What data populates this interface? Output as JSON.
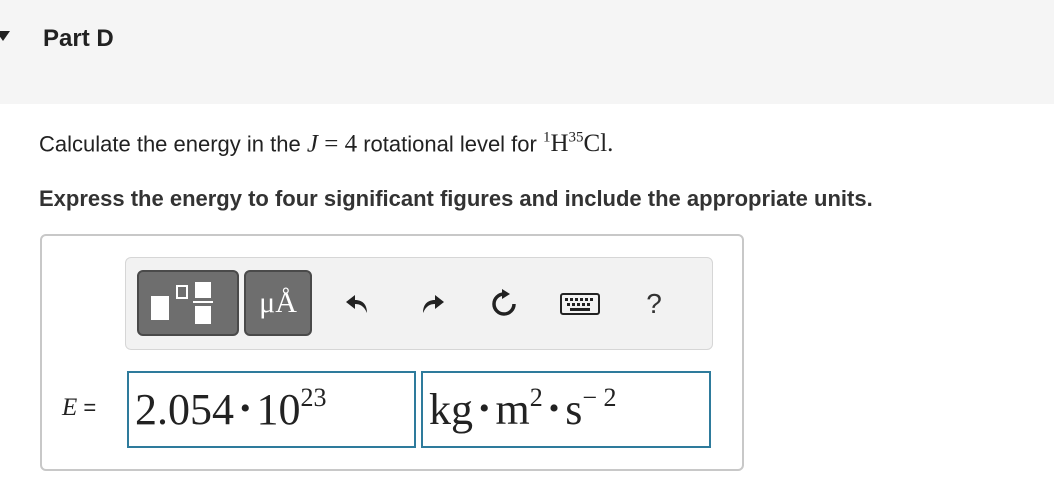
{
  "header": {
    "title": "Part D"
  },
  "question": {
    "prefix": "Calculate the energy in the",
    "var": "J",
    "eq": " = 4",
    "mid": "rotational level for",
    "iso1": "1",
    "el1": "H",
    "iso2": "35",
    "el2": "Cl."
  },
  "instruction": "Express the energy to four significant figures and include the appropriate units.",
  "toolbar": {
    "templates_icon": "templates-icon",
    "symbols_label": "μÅ",
    "undo_icon": "undo-icon",
    "redo_icon": "redo-icon",
    "reset_icon": "reset-icon",
    "keyboard_icon": "keyboard-icon",
    "help_label": "?"
  },
  "answer": {
    "var": "E",
    "equals": "=",
    "value_mantissa": "2.054",
    "value_base": "10",
    "value_exponent": "23",
    "units_kg": "kg",
    "units_m": "m",
    "units_m_exp": "2",
    "units_s": "s",
    "units_s_exp": "− 2",
    "dot": "•"
  },
  "colors": {
    "field_border": "#2e7b9c",
    "button_gray": "#6e6e6e"
  }
}
